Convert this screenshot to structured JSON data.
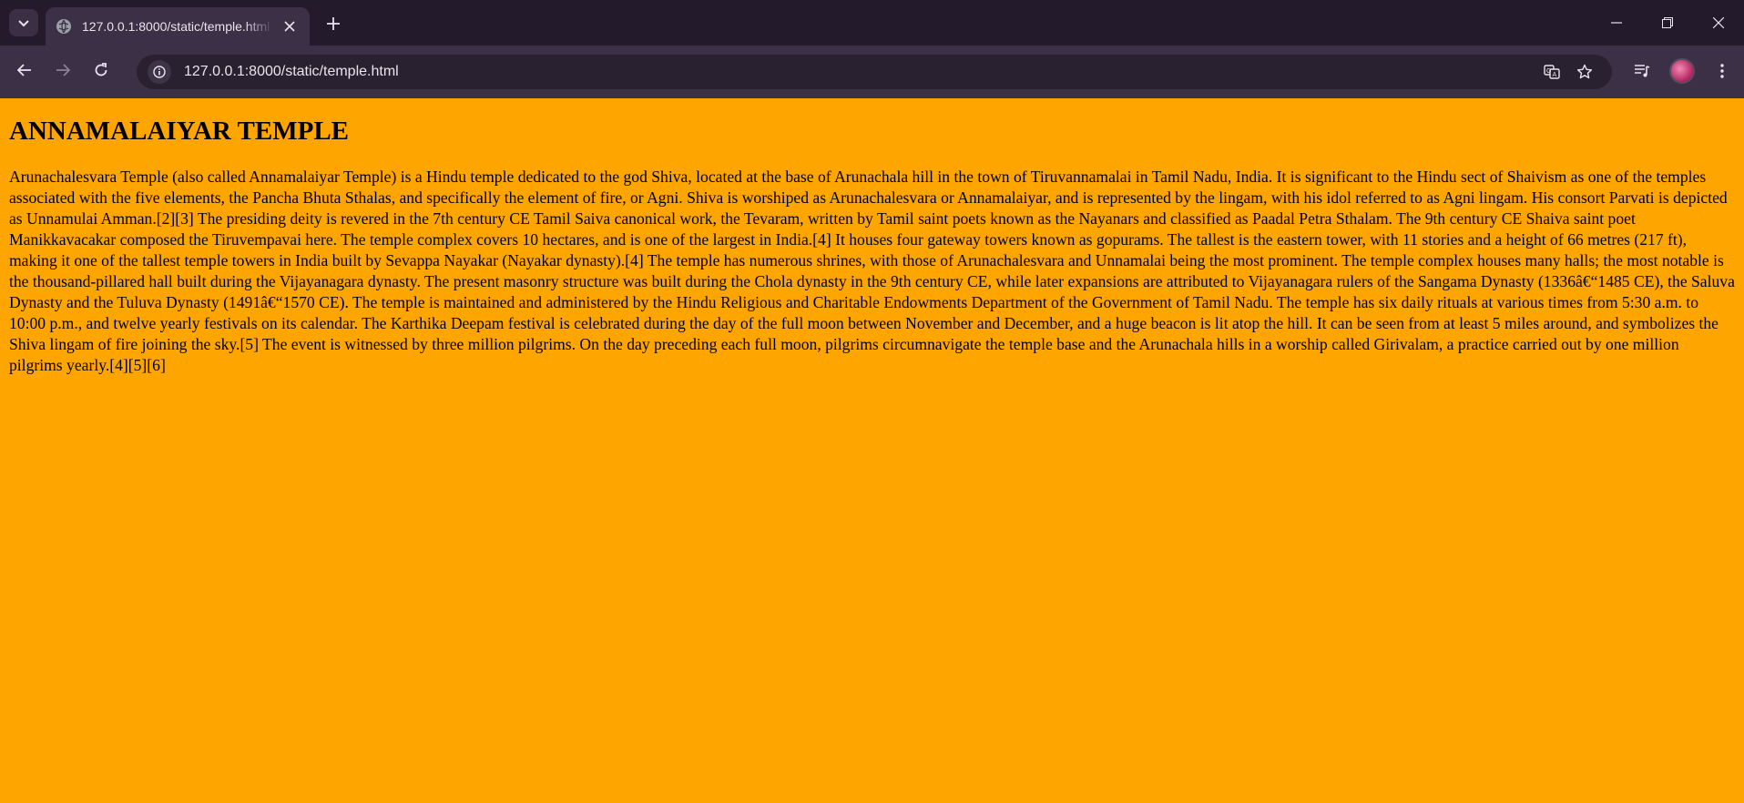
{
  "browser": {
    "tab_title": "127.0.0.1:8000/static/temple.html",
    "url": "127.0.0.1:8000/static/temple.html",
    "icons": {
      "tab_search": "chevron-down-icon",
      "favicon": "globe-icon",
      "tab_close": "close-icon",
      "new_tab": "plus-icon",
      "back": "arrow-left-icon",
      "forward": "arrow-right-icon",
      "reload": "reload-icon",
      "site_info": "info-icon",
      "translate": "translate-icon",
      "bookmark": "star-icon",
      "media": "media-queue-icon",
      "menu": "kebab-menu-icon"
    }
  },
  "page": {
    "background": "#ffa500",
    "heading": "ANNAMALAIYAR TEMPLE",
    "paragraph": "Arunachalesvara Temple (also called Annamalaiyar Temple) is a Hindu temple dedicated to the god Shiva, located at the base of Arunachala hill in the town of Tiruvannamalai in Tamil Nadu, India. It is significant to the Hindu sect of Shaivism as one of the temples associated with the five elements, the Pancha Bhuta Sthalas, and specifically the element of fire, or Agni. Shiva is worshiped as Arunachalesvara or Annamalaiyar, and is represented by the lingam, with his idol referred to as Agni lingam. His consort Parvati is depicted as Unnamulai Amman.[2][3] The presiding deity is revered in the 7th century CE Tamil Saiva canonical work, the Tevaram, written by Tamil saint poets known as the Nayanars and classified as Paadal Petra Sthalam. The 9th century CE Shaiva saint poet Manikkavacakar composed the Tiruvempavai here. The temple complex covers 10 hectares, and is one of the largest in India.[4] It houses four gateway towers known as gopurams. The tallest is the eastern tower, with 11 stories and a height of 66 metres (217 ft), making it one of the tallest temple towers in India built by Sevappa Nayakar (Nayakar dynasty).[4] The temple has numerous shrines, with those of Arunachalesvara and Unnamalai being the most prominent. The temple complex houses many halls; the most notable is the thousand-pillared hall built during the Vijayanagara dynasty. The present masonry structure was built during the Chola dynasty in the 9th century CE, while later expansions are attributed to Vijayanagara rulers of the Sangama Dynasty (1336â€“1485 CE), the Saluva Dynasty and the Tuluva Dynasty (1491â€“1570 CE). The temple is maintained and administered by the Hindu Religious and Charitable Endowments Department of the Government of Tamil Nadu. The temple has six daily rituals at various times from 5:30 a.m. to 10:00 p.m., and twelve yearly festivals on its calendar. The Karthika Deepam festival is celebrated during the day of the full moon between November and December, and a huge beacon is lit atop the hill. It can be seen from at least 5 miles around, and symbolizes the Shiva lingam of fire joining the sky.[5] The event is witnessed by three million pilgrims. On the day preceding each full moon, pilgrims circumnavigate the temple base and the Arunachala hills in a worship called Girivalam, a practice carried out by one million pilgrims yearly.[4][5][6]"
  }
}
